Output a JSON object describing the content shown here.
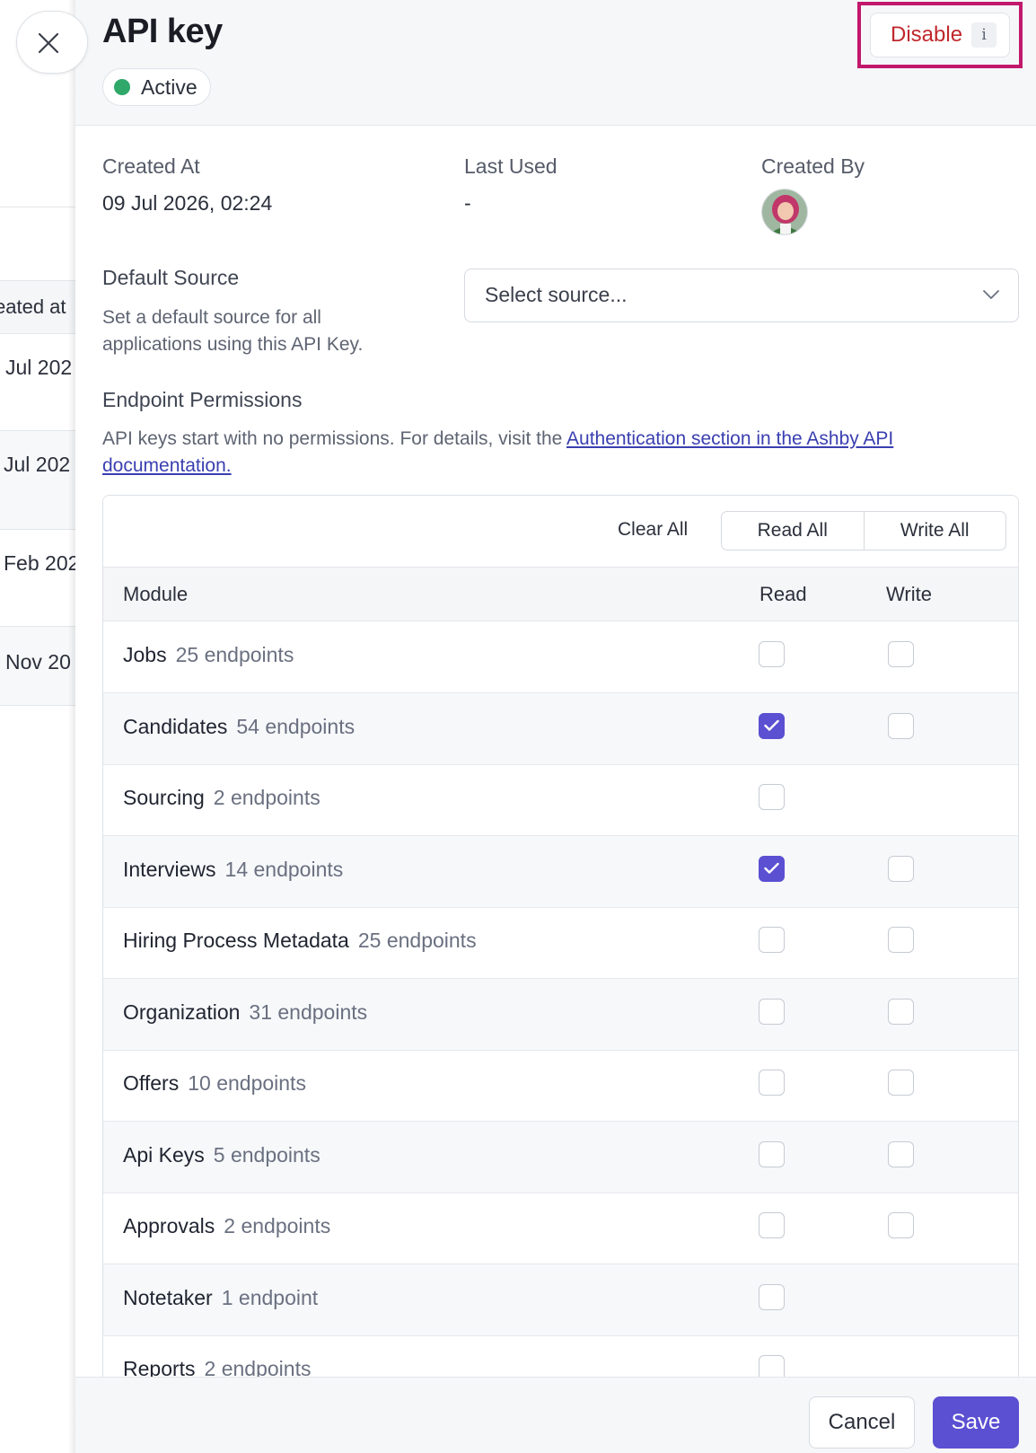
{
  "background": {
    "column_header": "eated at",
    "rows": [
      "Jul 202",
      "Jul 202",
      "Feb 202",
      "Nov 20"
    ]
  },
  "drawer": {
    "title": "API key",
    "status": "Active",
    "status_color": "#2fa86a",
    "disable_label": "Disable",
    "disable_info": "i",
    "highlight_color": "#c2186b"
  },
  "meta": {
    "created_at_label": "Created At",
    "created_at_value": "09 Jul 2026, 02:24",
    "last_used_label": "Last Used",
    "last_used_value": "-",
    "created_by_label": "Created By"
  },
  "default_source": {
    "title": "Default Source",
    "description_line1": "Set a default source for all",
    "description_line2": "applications using this API Key.",
    "placeholder": "Select source..."
  },
  "permissions": {
    "title": "Endpoint Permissions",
    "description": "API keys start with no permissions. For details, visit the ",
    "link_line1": "Authentication section in the Ashby API",
    "link_line2": "documentation.",
    "clear_all": "Clear All",
    "read_all": "Read All",
    "write_all": "Write All",
    "columns": {
      "module": "Module",
      "read": "Read",
      "write": "Write"
    },
    "accent_color": "#5b4fd2",
    "rows": [
      {
        "name": "Jobs",
        "count": "25 endpoints",
        "read": false,
        "write": false,
        "has_write": true
      },
      {
        "name": "Candidates",
        "count": "54 endpoints",
        "read": true,
        "write": false,
        "has_write": true
      },
      {
        "name": "Sourcing",
        "count": "2 endpoints",
        "read": false,
        "write": false,
        "has_write": false
      },
      {
        "name": "Interviews",
        "count": "14 endpoints",
        "read": true,
        "write": false,
        "has_write": true
      },
      {
        "name": "Hiring Process Metadata",
        "count": "25 endpoints",
        "read": false,
        "write": false,
        "has_write": true
      },
      {
        "name": "Organization",
        "count": "31 endpoints",
        "read": false,
        "write": false,
        "has_write": true
      },
      {
        "name": "Offers",
        "count": "10 endpoints",
        "read": false,
        "write": false,
        "has_write": true
      },
      {
        "name": "Api Keys",
        "count": "5 endpoints",
        "read": false,
        "write": false,
        "has_write": true
      },
      {
        "name": "Approvals",
        "count": "2 endpoints",
        "read": false,
        "write": false,
        "has_write": true
      },
      {
        "name": "Notetaker",
        "count": "1 endpoint",
        "read": false,
        "write": false,
        "has_write": false
      },
      {
        "name": "Reports",
        "count": "2 endpoints",
        "read": false,
        "write": false,
        "has_write": false
      }
    ]
  },
  "footer": {
    "cancel": "Cancel",
    "save": "Save"
  }
}
